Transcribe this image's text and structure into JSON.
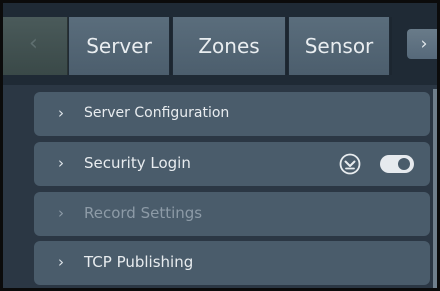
{
  "tabs": {
    "back_icon": "chevron-left-icon",
    "back_glyph": "‹",
    "items": [
      {
        "label": "Server",
        "active": true
      },
      {
        "label": "Zones",
        "active": false
      },
      {
        "label": "Sensor",
        "active": false
      }
    ],
    "forward_icon": "chevron-right-icon",
    "forward_glyph": "›"
  },
  "rows": [
    {
      "label": "Server Configuration",
      "chevron": "›",
      "dimmed": false
    },
    {
      "label": "Security Login",
      "chevron": "›",
      "dimmed": false,
      "icons": [
        "chevron-down-circle-icon",
        "toggle-switch"
      ],
      "toggle_on": true
    },
    {
      "label": "Record Settings",
      "chevron": "›",
      "dimmed": true
    },
    {
      "label": "TCP Publishing",
      "chevron": "›",
      "dimmed": false
    }
  ],
  "colors": {
    "panel_bg": "#2b3744",
    "row_bg": "#4a5c6b",
    "tab_bg": "#56697a",
    "text": "#e8ecef",
    "dim_text": "#8d9ba7"
  }
}
